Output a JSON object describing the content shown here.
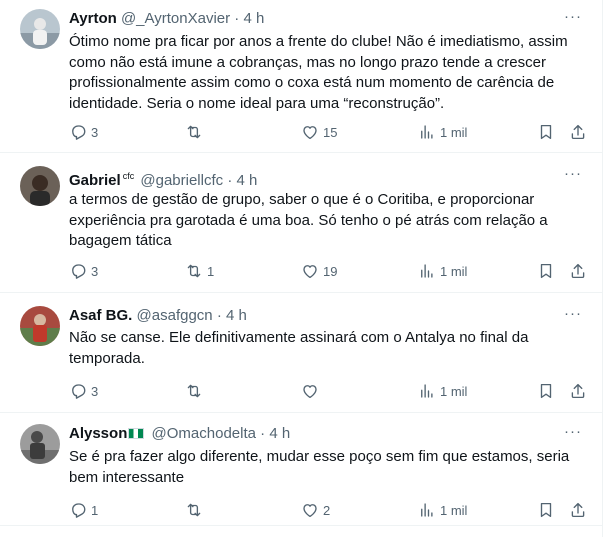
{
  "tweets": [
    {
      "name": "Ayrton",
      "handle": "@_AyrtonXavier",
      "dot": "·",
      "time": "4 h",
      "badge": "",
      "text": "Ótimo nome pra ficar por anos a frente do clube! Não é imediatismo, assim como não está imune a cobranças, mas no longo prazo tende a crescer profissionalmente assim como o coxa está num momento de carência de identidade. Seria o nome ideal para uma “reconstrução”.",
      "replies": "3",
      "retweets": "",
      "likes": "15",
      "views": "1 mil"
    },
    {
      "name": "Gabriel",
      "handle": "@gabriellcfc",
      "dot": "·",
      "time": "4 h",
      "badge": "cfc",
      "text": "a termos de gestão de grupo, saber o que é o Coritiba, e proporcionar experiência pra garotada é uma boa. Só tenho o pé atrás com relação a bagagem tática",
      "replies": "3",
      "retweets": "1",
      "likes": "19",
      "views": "1 mil"
    },
    {
      "name": "Asaf BG.",
      "handle": "@asafggcn",
      "dot": "·",
      "time": "4 h",
      "badge": "",
      "text": "Não se canse. Ele definitivamente assinará com o Antalya no final da temporada.",
      "replies": "3",
      "retweets": "",
      "likes": "",
      "views": "1 mil"
    },
    {
      "name": "Alysson",
      "handle": "@Omachodelta",
      "dot": "·",
      "time": "4 h",
      "badge": "",
      "text": "Se é pra fazer algo diferente, mudar esse poço sem fim que estamos, seria bem interessante",
      "replies": "1",
      "retweets": "",
      "likes": "2",
      "views": "1 mil"
    }
  ],
  "more_glyph": "···",
  "icons": [
    "reply-icon",
    "retweet-icon",
    "like-icon",
    "views-icon",
    "bookmark-icon",
    "share-icon",
    "more-icon"
  ],
  "colors": {
    "text": "#0f1419",
    "secondary": "#536471",
    "divider": "#eff3f4",
    "flag_green": "#008751"
  }
}
